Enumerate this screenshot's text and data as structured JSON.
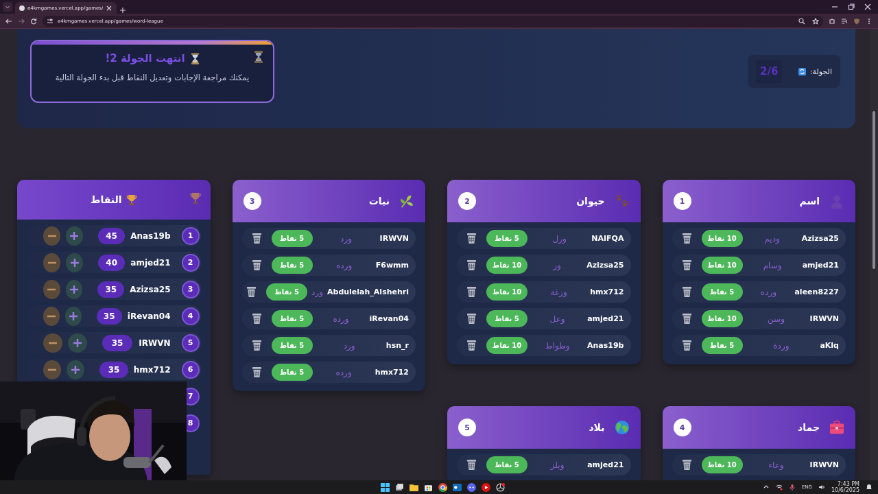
{
  "browser": {
    "tab_title": "e4kmgames.vercel.app/games/",
    "address": "e4kmgames.vercel.app/games/word-league"
  },
  "round_notice": {
    "title": "انتهت الجولة 2!",
    "message": "يمكنك مراجعة الإجابات وتعديل النقاط قبل بدء الجولة التالية"
  },
  "round_counter": {
    "label": "الجولة:",
    "value": "2/6"
  },
  "scores": {
    "title": "النقاط",
    "rows": [
      {
        "rank": "1",
        "name": "Anas19b",
        "score": "45"
      },
      {
        "rank": "2",
        "name": "amjed21",
        "score": "40"
      },
      {
        "rank": "3",
        "name": "Azizsa25",
        "score": "35"
      },
      {
        "rank": "4",
        "name": "iRevan04",
        "score": "35"
      },
      {
        "rank": "5",
        "name": "IRWVN",
        "score": "35"
      },
      {
        "rank": "6",
        "name": "hmx712",
        "score": "35"
      },
      {
        "rank": "7"
      },
      {
        "rank": "8"
      }
    ]
  },
  "categories": [
    {
      "title": "اسم",
      "number": "1",
      "rows": [
        {
          "player": "Azizsa25",
          "answer": "وديم",
          "points": "10 نقاط"
        },
        {
          "player": "amjed21",
          "answer": "وسام",
          "points": "10 نقاط"
        },
        {
          "player": "aleen8227",
          "answer": "ورده",
          "points": "5 نقاط"
        },
        {
          "player": "IRWVN",
          "answer": "وسن",
          "points": "10 نقاط"
        },
        {
          "player": "aKlq",
          "answer": "وردة",
          "points": "5 نقاط"
        }
      ]
    },
    {
      "title": "حيوان",
      "number": "2",
      "rows": [
        {
          "player": "NAIFQA",
          "answer": "ورل",
          "points": "5 نقاط"
        },
        {
          "player": "Azizsa25",
          "answer": "وز",
          "points": "10 نقاط"
        },
        {
          "player": "hmx712",
          "answer": "وزغة",
          "points": "10 نقاط"
        },
        {
          "player": "amjed21",
          "answer": "وعل",
          "points": "5 نقاط"
        },
        {
          "player": "Anas19b",
          "answer": "وطواط",
          "points": "10 نقاط"
        }
      ]
    },
    {
      "title": "نبات",
      "number": "3",
      "rows": [
        {
          "player": "IRWVN",
          "answer": "ورد",
          "points": "5 نقاط"
        },
        {
          "player": "F6wmm",
          "answer": "ورده",
          "points": "5 نقاط"
        },
        {
          "player": "Abdulelah_Alshehri",
          "answer": "ورد",
          "points": "5 نقاط"
        },
        {
          "player": "iRevan04",
          "answer": "ورده",
          "points": "5 نقاط"
        },
        {
          "player": "hsn_r",
          "answer": "ورد",
          "points": "5 نقاط"
        },
        {
          "player": "hmx712",
          "answer": "ورده",
          "points": "5 نقاط"
        }
      ]
    },
    {
      "title": "جماد",
      "number": "4",
      "rows": [
        {
          "player": "IRWVN",
          "answer": "وعاء",
          "points": "10 نقاط"
        }
      ]
    },
    {
      "title": "بلاد",
      "number": "5",
      "rows": [
        {
          "player": "amjed21",
          "answer": "ويلز",
          "points": "5 نقاط"
        }
      ]
    }
  ],
  "taskbar": {
    "language": "ENG",
    "time": "7:43 PM",
    "date": "10/6/2025"
  }
}
